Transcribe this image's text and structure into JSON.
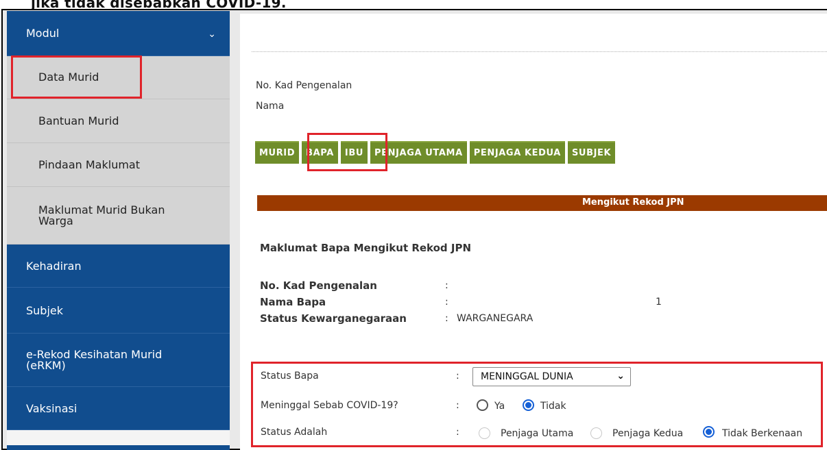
{
  "caption": "jika tidak disebabkan COVID-19.",
  "sidebar": {
    "modul": "Modul",
    "sub_items": [
      "Data Murid",
      "Bantuan Murid",
      "Pindaan Maklumat",
      "Maklumat Murid Bukan Warga"
    ],
    "items": [
      "Kehadiran",
      "Subjek",
      "e-Rekod Kesihatan Murid (eRKM)",
      "Vaksinasi"
    ]
  },
  "student": {
    "ic_label": "No. Kad Pengenalan",
    "name_label": "Nama"
  },
  "tabs": [
    "MURID",
    "BAPA",
    "IBU",
    "PENJAGA UTAMA",
    "PENJAGA KEDUA",
    "SUBJEK"
  ],
  "section_bar": "Mengikut Rekod JPN",
  "father": {
    "heading": "Maklumat Bapa Mengikut Rekod JPN",
    "ic_label": "No. Kad Pengenalan",
    "name_label": "Nama Bapa",
    "name_tail": "1",
    "citizen_label": "Status Kewarganegaraan",
    "citizen_value": "WARGANEGARA"
  },
  "form": {
    "colon": ":",
    "status_label": "Status Bapa",
    "status_value": "MENINGGAL DUNIA",
    "covid_label": "Meninggal Sebab COVID-19?",
    "covid_options": [
      "Ya",
      "Tidak"
    ],
    "covid_selected": "Tidak",
    "role_label": "Status Adalah",
    "role_options": [
      "Penjaga Utama",
      "Penjaga Kedua",
      "Tidak Berkenaan"
    ],
    "role_selected": "Tidak Berkenaan"
  },
  "icons": {
    "chevron": "chevron-down-icon",
    "select_arrow": "chevron-down-icon"
  },
  "colors": {
    "sidebar_blue": "#114d8e",
    "tab_green": "#6f8d2a",
    "bar_brown": "#9b3a00",
    "highlight_red": "#e0232a",
    "radio_blue": "#1560d6"
  }
}
